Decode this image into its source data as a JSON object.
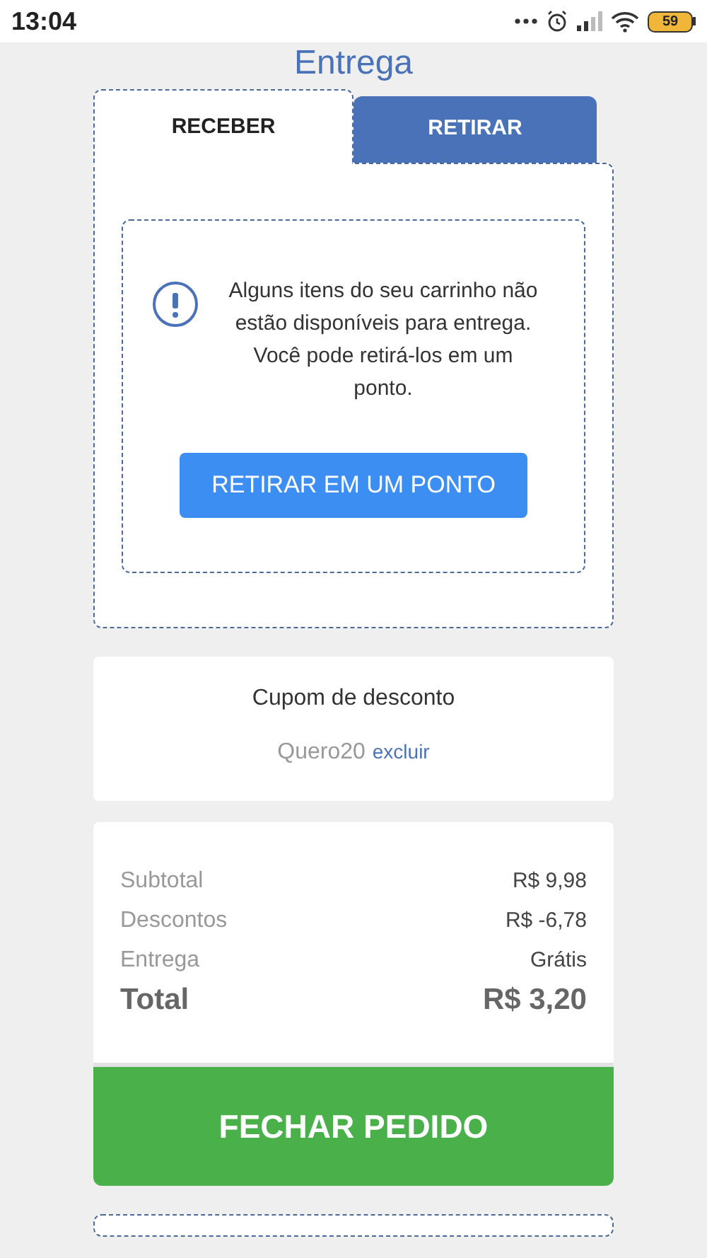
{
  "status_bar": {
    "time": "13:04",
    "battery": "59"
  },
  "title": "Entrega",
  "tabs": [
    {
      "label": "RECEBER",
      "selected": true
    },
    {
      "label": "RETIRAR",
      "selected": false
    }
  ],
  "notice": {
    "message": "Alguns itens do seu carrinho não estão disponíveis para entrega. Você pode retirá-los em um ponto.",
    "button": "RETIRAR EM UM PONTO"
  },
  "coupon": {
    "title": "Cupom de desconto",
    "code": "Quero20",
    "remove": "excluir"
  },
  "summary": [
    {
      "label": "Subtotal",
      "value": "R$ 9,98",
      "kind": "line"
    },
    {
      "label": "Descontos",
      "value": "R$ -6,78",
      "kind": "line"
    },
    {
      "label": "Entrega",
      "value": "Grátis",
      "kind": "line"
    },
    {
      "label": "Total",
      "value": "R$ 3,20",
      "kind": "total"
    }
  ],
  "checkout_button": "FECHAR PEDIDO"
}
